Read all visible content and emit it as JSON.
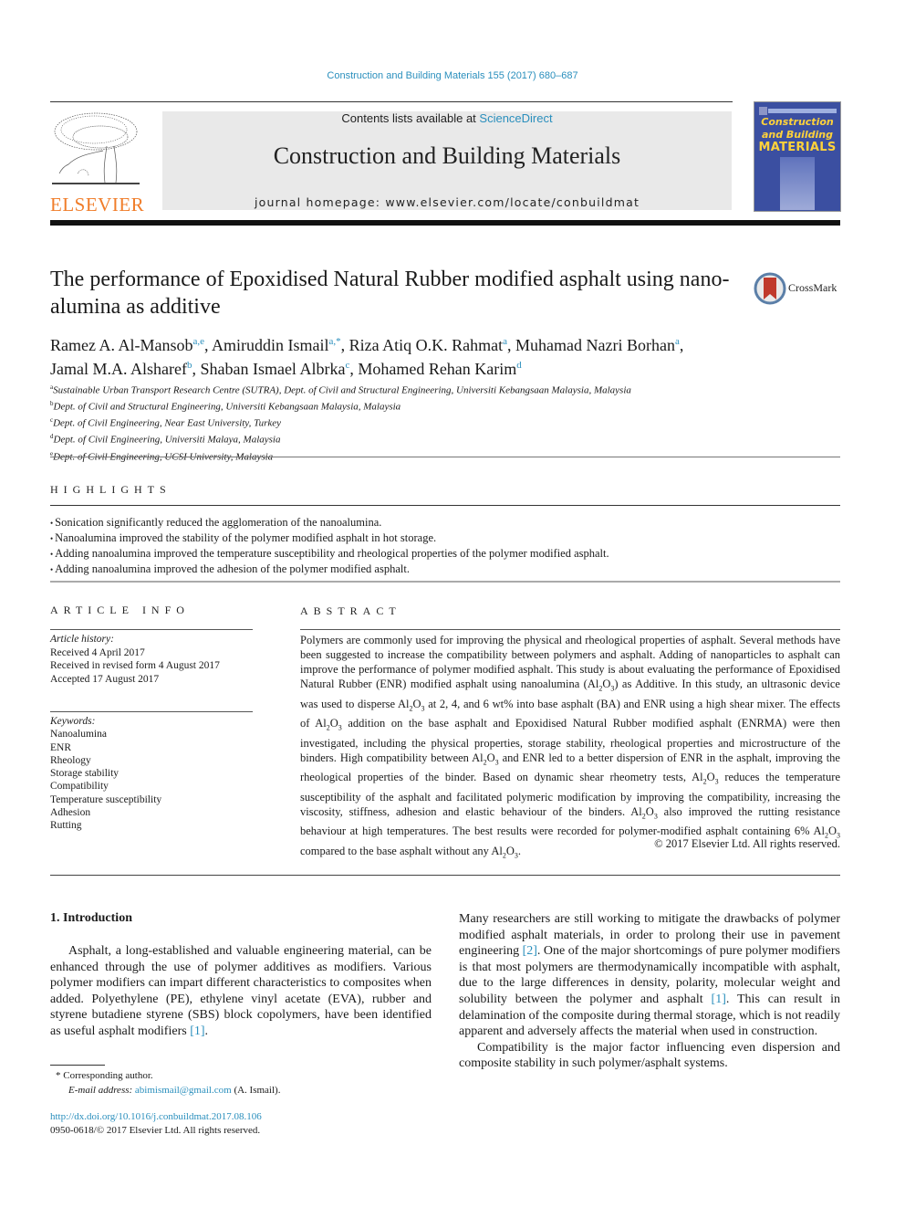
{
  "header": {
    "citation": "Construction and Building Materials 155 (2017) 680–687",
    "contents_prefix": "Contents lists available at ",
    "contents_link": "ScienceDirect",
    "journal_title": "Construction and Building Materials",
    "homepage": "journal homepage: www.elsevier.com/locate/conbuildmat",
    "publisher_logo": "ELSEVIER",
    "cover": {
      "line1": "Construction",
      "line2": "and Building",
      "line3": "MATERIALS"
    },
    "accent_color": "#2a8fbd",
    "publisher_color": "#f07d2a",
    "cover_color": "#3b4fa1"
  },
  "article": {
    "title": "The performance of Epoxidised Natural Rubber modified asphalt using nano-alumina as additive",
    "crossmark_label": "CrossMark",
    "authors": [
      {
        "name": "Ramez A. Al-Mansob",
        "aff": "a,e",
        "sep": ", "
      },
      {
        "name": "Amiruddin Ismail",
        "aff": "a,*",
        "sep": ", "
      },
      {
        "name": "Riza Atiq O.K. Rahmat",
        "aff": "a",
        "sep": ", "
      },
      {
        "name": "Muhamad Nazri Borhan",
        "aff": "a",
        "sep": ","
      },
      {
        "name": "Jamal M.A. Alsharef",
        "aff": "b",
        "sep": ", "
      },
      {
        "name": "Shaban Ismael Albrka",
        "aff": "c",
        "sep": ", "
      },
      {
        "name": "Mohamed Rehan Karim",
        "aff": "d",
        "sep": ""
      }
    ],
    "affiliations": [
      {
        "key": "a",
        "text": "Sustainable Urban Transport Research Centre (SUTRA), Dept. of Civil and Structural Engineering, Universiti Kebangsaan Malaysia, Malaysia"
      },
      {
        "key": "b",
        "text": "Dept. of Civil and Structural Engineering, Universiti Kebangsaan Malaysia, Malaysia"
      },
      {
        "key": "c",
        "text": "Dept. of Civil Engineering, Near East University, Turkey"
      },
      {
        "key": "d",
        "text": "Dept. of Civil Engineering, Universiti Malaya, Malaysia"
      },
      {
        "key": "e",
        "text": "Dept. of Civil Engineering, UCSI University, Malaysia"
      }
    ]
  },
  "highlights": {
    "heading": "HIGHLIGHTS",
    "items": [
      "Sonication significantly reduced the agglomeration of the nanoalumina.",
      "Nanoalumina improved the stability of the polymer modified asphalt in hot storage.",
      "Adding nanoalumina improved the temperature susceptibility and rheological properties of the polymer modified asphalt.",
      "Adding nanoalumina improved the adhesion of the polymer modified asphalt."
    ]
  },
  "article_info": {
    "heading": "ARTICLE INFO",
    "history_label": "Article history:",
    "history": [
      "Received 4 April 2017",
      "Received in revised form 4 August 2017",
      "Accepted 17 August 2017"
    ],
    "keywords_label": "Keywords:",
    "keywords": [
      "Nanoalumina",
      "ENR",
      "Rheology",
      "Storage stability",
      "Compatibility",
      "Temperature susceptibility",
      "Adhesion",
      "Rutting"
    ]
  },
  "abstract": {
    "heading": "ABSTRACT",
    "p1": "Polymers are commonly used for improving the physical and rheological properties of asphalt. Several methods have been suggested to increase the compatibility between polymers and asphalt. Adding of nanoparticles to asphalt can improve the performance of polymer modified asphalt. This study is about evaluating the performance of Epoxidised Natural Rubber (ENR) modified asphalt using nanoalumina (",
    "p2": ") as Additive. In this study, an ultrasonic device was used to disperse ",
    "p3": " at 2, 4, and 6 wt% into base asphalt (BA) and ENR using a high shear mixer. The effects of ",
    "p4": " addition on the base asphalt and Epoxidised Natural Rubber modified asphalt (ENRMA) were then investigated, including the physical properties, storage stability, rheological properties and microstructure of the binders. High compatibility between ",
    "p5": " and ENR led to a better dispersion of ENR in the asphalt, improving the rheological properties of the binder. Based on dynamic shear rheometry tests, ",
    "p6": " reduces the temperature susceptibility of the asphalt and facilitated polymeric modification by improving the compatibility, increasing the viscosity, stiffness, adhesion and elastic behaviour of the binders. ",
    "p7": " also improved the rutting resistance behaviour at high temperatures. The best results were recorded for polymer-modified asphalt containing 6% ",
    "p8": " compared to the base asphalt without any ",
    "p9": ".",
    "chem_al": "Al",
    "chem_2": "2",
    "chem_o": "O",
    "chem_3": "3",
    "copyright": "© 2017 Elsevier Ltd. All rights reserved."
  },
  "intro": {
    "heading": "1. Introduction",
    "col1_text": "Asphalt, a long-established and valuable engineering material, can be enhanced through the use of polymer additives as modifiers. Various polymer modifiers can impart different characteristics to composites when added. Polyethylene (PE), ethylene vinyl acetate (EVA), rubber and styrene butadiene styrene (SBS) block copolymers, have been identified as useful asphalt modifiers ",
    "col1_ref": "[1]",
    "col1_end": ".",
    "col2_a": "Many researchers are still working to mitigate the drawbacks of polymer modified asphalt materials, in order to prolong their use in pavement engineering ",
    "col2_ref1": "[2]",
    "col2_b": ". One of the major shortcomings of pure polymer modifiers is that most polymers are thermodynamically incompatible with asphalt, due to the large differences in density, polarity, molecular weight and solubility between the polymer and asphalt ",
    "col2_ref2": "[1]",
    "col2_c": ". This can result in delamination of the composite during thermal storage, which is not readily apparent and adversely affects the material when used in construction.",
    "col2_p2": "Compatibility is the major factor influencing even dispersion and composite stability in such polymer/asphalt systems."
  },
  "footnotes": {
    "star": "* Corresponding author.",
    "email_label": "E-mail address: ",
    "email": "abimismail@gmail.com",
    "email_suffix": " (A. Ismail).",
    "doi": "http://dx.doi.org/10.1016/j.conbuildmat.2017.08.106",
    "issn": "0950-0618/© 2017 Elsevier Ltd. All rights reserved."
  }
}
